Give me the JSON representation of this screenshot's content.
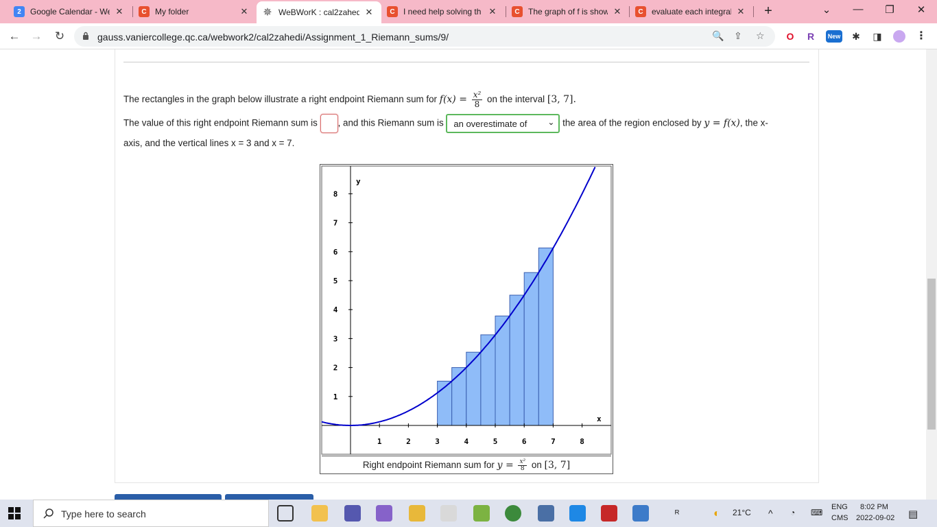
{
  "browser": {
    "tabs": [
      {
        "title": "Google Calendar - We",
        "favicon_text": "2",
        "favicon_color": "#4285f4"
      },
      {
        "title": "My folder",
        "favicon_text": "C",
        "favicon_color": "#e8502f"
      },
      {
        "title": "WeBWorK : cal2zahed",
        "favicon_text": "✵",
        "favicon_color": "#555555"
      },
      {
        "title": "I need help solving th",
        "favicon_text": "C",
        "favicon_color": "#e8502f"
      },
      {
        "title": "The graph of f is show",
        "favicon_text": "C",
        "favicon_color": "#e8502f"
      },
      {
        "title": "evaluate each integral",
        "favicon_text": "C",
        "favicon_color": "#e8502f"
      }
    ],
    "url": "gauss.vaniercollege.qc.ca/webwork2/cal2zahedi/Assignment_1_Riemann_sums/9/",
    "extensions": [
      {
        "name": "opera-extension-icon",
        "label": "O",
        "color": "#e0102a"
      },
      {
        "name": "r-extension-icon",
        "label": "R",
        "color": "#7a3fb3"
      },
      {
        "name": "new-extension-icon",
        "label": "New",
        "color": "#1a6fd1"
      }
    ]
  },
  "problem": {
    "line1_prefix": "The rectangles in the graph below illustrate a right endpoint Riemann sum for",
    "function_lhs": "f(x) =",
    "function_num": "x²",
    "function_den": "8",
    "line1_mid": "on the interval",
    "interval": "[3, 7].",
    "line2_prefix": "The value of this right endpoint Riemann sum is",
    "line2_mid": ", and this Riemann sum is",
    "select_value": "an overestimate of",
    "line2_suffix_a": "the area of the region enclosed by",
    "line2_math": "y = f(x)",
    "line2_suffix_b": ", the x-",
    "line3": "axis, and the vertical lines x = 3 and x = 7."
  },
  "graph": {
    "caption_prefix": "Right endpoint Riemann sum for",
    "caption_math": "y =",
    "caption_num": "x²",
    "caption_den": "8",
    "caption_on": "on",
    "caption_interval": "[3, 7]"
  },
  "chart_data": {
    "type": "bar",
    "function": "x^2/8",
    "interval": [
      3,
      7
    ],
    "rectangle_width": 0.5,
    "rectangles": [
      {
        "x_left": 3.0,
        "x_right": 3.5,
        "height": 1.53
      },
      {
        "x_left": 3.5,
        "x_right": 4.0,
        "height": 2.0
      },
      {
        "x_left": 4.0,
        "x_right": 4.5,
        "height": 2.53
      },
      {
        "x_left": 4.5,
        "x_right": 5.0,
        "height": 3.13
      },
      {
        "x_left": 5.0,
        "x_right": 5.5,
        "height": 3.78
      },
      {
        "x_left": 5.5,
        "x_right": 6.0,
        "height": 4.5
      },
      {
        "x_left": 6.0,
        "x_right": 6.5,
        "height": 5.28
      },
      {
        "x_left": 6.5,
        "x_right": 7.0,
        "height": 6.13
      }
    ],
    "x_ticks": [
      "1",
      "2",
      "3",
      "4",
      "5",
      "6",
      "7",
      "8"
    ],
    "y_ticks": [
      "1",
      "2",
      "3",
      "4",
      "5",
      "6",
      "7",
      "8"
    ],
    "xlabel": "x",
    "ylabel": "y",
    "xlim": [
      -1,
      9
    ],
    "ylim": [
      -1,
      9
    ],
    "bar_color": "#8fbcf8",
    "curve_color": "#0000cc"
  },
  "taskbar": {
    "search_placeholder": "Type here to search",
    "weather": "21°C",
    "language": "ENG",
    "keyboard": "CMS",
    "time": "8:02 PM",
    "date": "2022-09-02"
  }
}
